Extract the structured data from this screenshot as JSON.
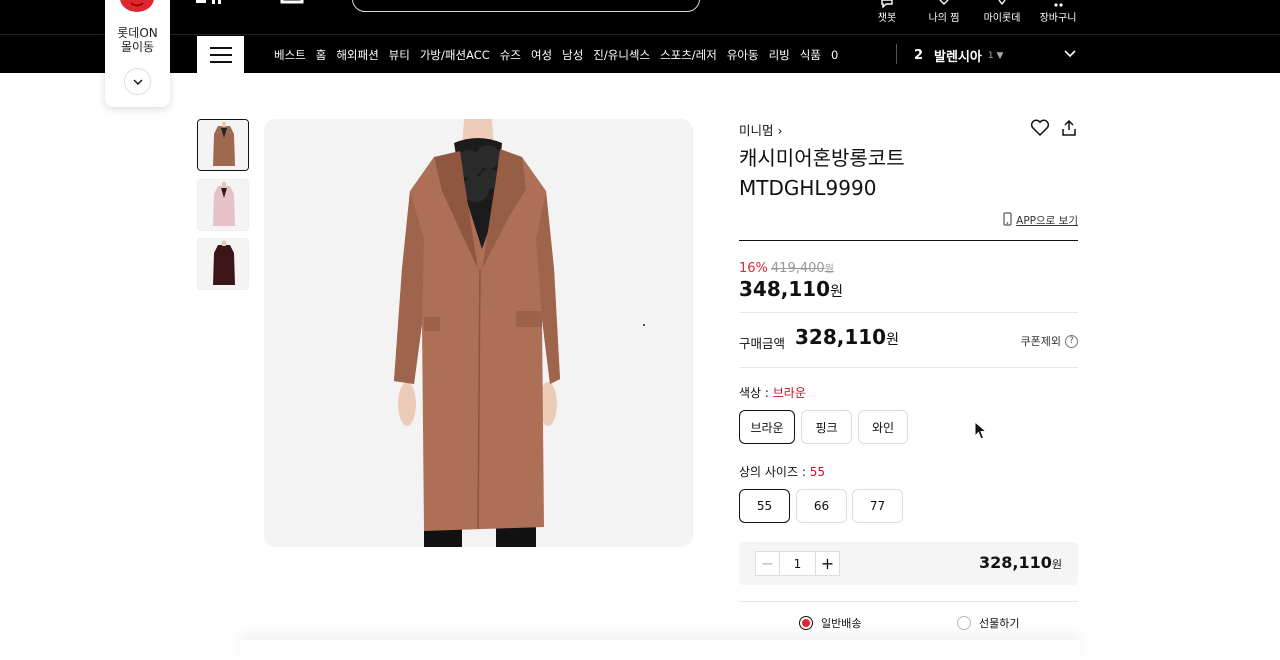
{
  "header": {
    "util": [
      {
        "label": "챗봇",
        "icon": "chat-icon"
      },
      {
        "label": "나의 찜",
        "icon": "heart-icon"
      },
      {
        "label": "마이롯데",
        "icon": "user-icon"
      },
      {
        "label": "장바구니",
        "icon": "cart-icon"
      }
    ]
  },
  "mascot": {
    "label_line1": "롯데ON",
    "label_line2": "몰이동"
  },
  "nav": {
    "items": [
      "베스트",
      "홈",
      "해외패션",
      "뷰티",
      "가방/패션ACC",
      "슈즈",
      "여성",
      "남성",
      "진/유니섹스",
      "스포츠/레저",
      "유아동",
      "리빙",
      "식품",
      "0"
    ],
    "rank_number": "2",
    "rank_keyword": "발렌시아",
    "rank_change": "1 ▼"
  },
  "product": {
    "brand": "미니멈",
    "title_line1": "캐시미어혼방롱코트",
    "title_line2": "MTDGHL9990",
    "app_link": "APP으로 보기",
    "discount_rate": "16%",
    "original_price": "419,400",
    "original_unit": "원",
    "price": "348,110",
    "price_unit": "원",
    "buy_label": "구매금액",
    "buy_price": "328,110",
    "buy_unit": "원",
    "coupon_label": "쿠폰제외",
    "color_label": "색상 : ",
    "color_selected": "브라운",
    "colors": [
      "브라운",
      "핑크",
      "와인"
    ],
    "size_label": "상의 사이즈 : ",
    "size_selected": "55",
    "sizes": [
      "55",
      "66",
      "77"
    ],
    "quantity": "1",
    "line_total": "328,110",
    "line_unit": "원",
    "delivery_options": [
      "일반배송",
      "선물하기"
    ]
  },
  "colors": {
    "accent": "#e0272f",
    "selected_option": "#c8102e"
  }
}
